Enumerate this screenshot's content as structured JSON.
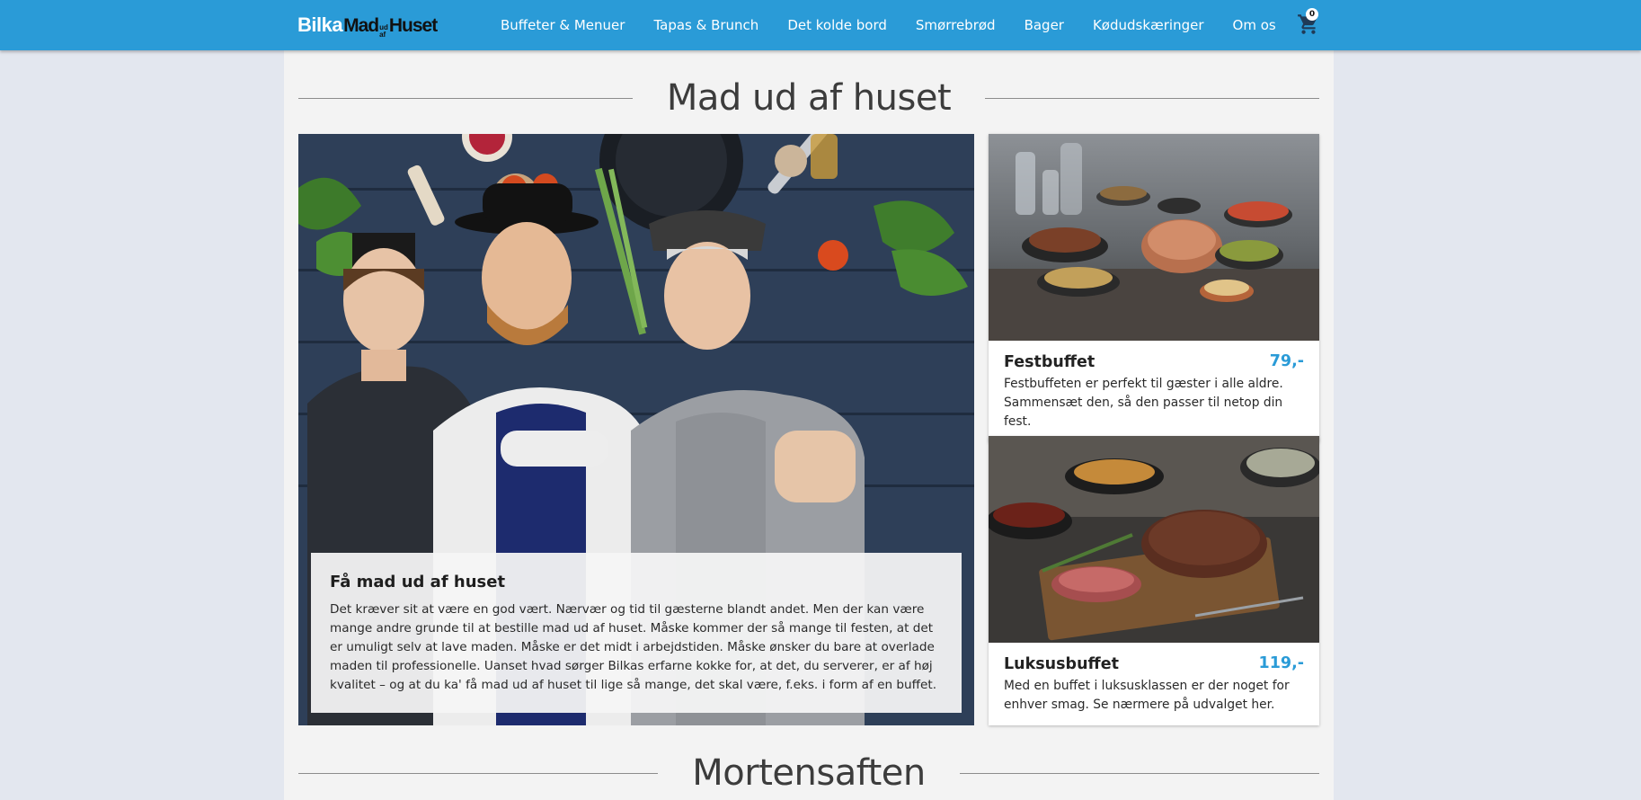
{
  "header": {
    "logo": {
      "part1": "Bilka",
      "part2": "Mad",
      "small_top": "ud",
      "small_bottom": "af",
      "part3": "Huset"
    },
    "nav": [
      "Buffeter & Menuer",
      "Tapas & Brunch",
      "Det kolde bord",
      "Smørrebrød",
      "Bager",
      "Kødudskæringer",
      "Om os"
    ],
    "cart_count": "0",
    "brand_color": "#2a9bd7"
  },
  "main": {
    "section_title": "Mad ud af huset",
    "hero": {
      "title": "Få mad ud af huset",
      "text": "Det kræver sit at være en god vært. Nærvær og tid til gæsterne blandt andet. Men der kan være mange andre grunde til at bestille mad ud af huset. Måske kommer der så mange til festen, at det er umuligt selv at lave maden. Måske er det midt i arbejdstiden. Måske ønsker du bare at overlade maden til professionelle. Uanset hvad sørger Bilkas erfarne kokke for, at det, du serverer, er af høj kvalitet – og at du ka' få mad ud af huset til lige så mange, det skal være, f.eks. i form af en buffet."
    },
    "cards": [
      {
        "name": "Festbuffet",
        "price": "79,-",
        "desc": "Festbuffeten er perfekt til gæster i alle aldre. Sammensæt den, så den passer til netop din fest."
      },
      {
        "name": "Luksusbuffet",
        "price": "119,-",
        "desc": "Med en buffet i luksusklassen er der noget for enhver smag. Se nærmere på udvalget her."
      }
    ],
    "next_section_title": "Mortensaften"
  }
}
